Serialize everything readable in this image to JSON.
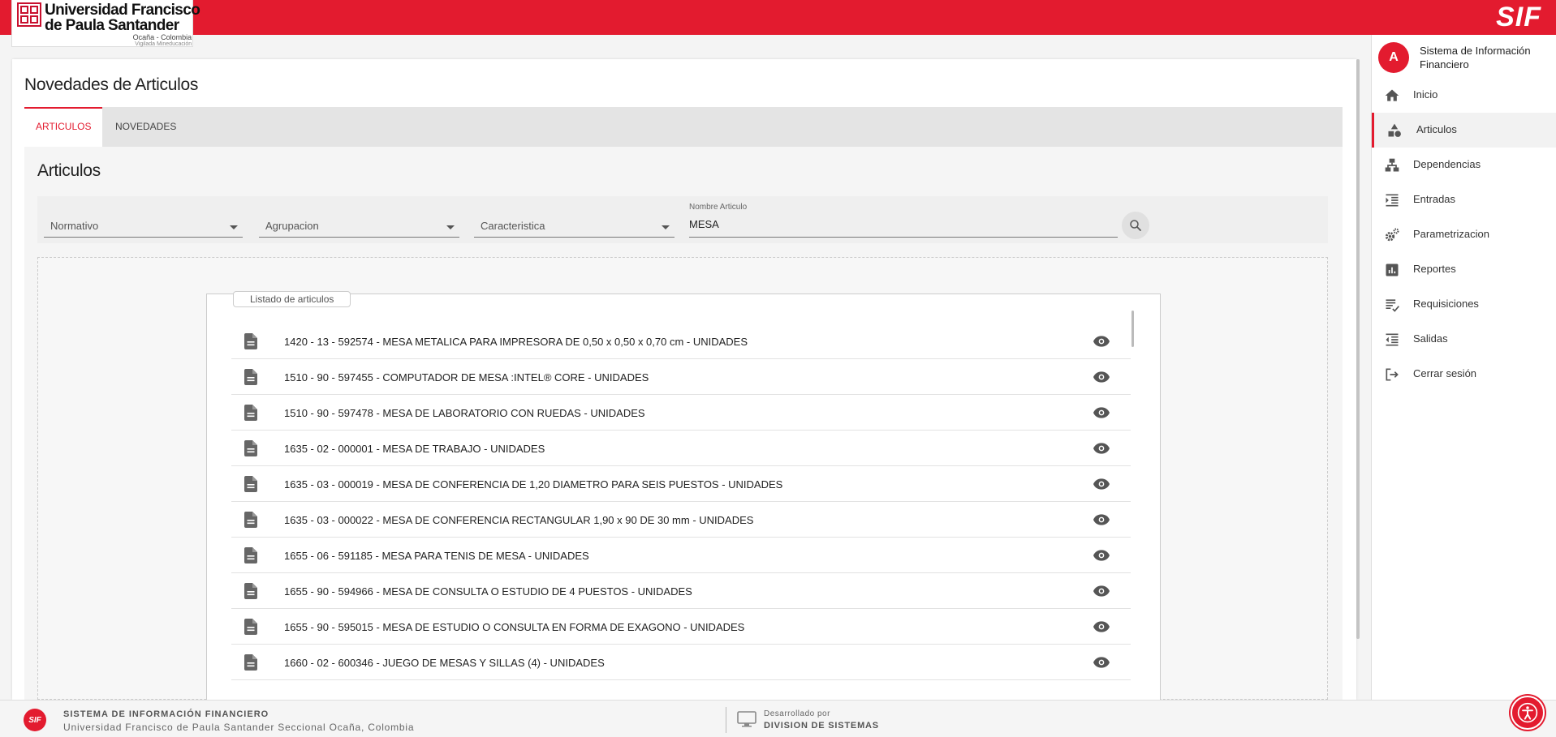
{
  "header": {
    "logo": {
      "line1": "Universidad Francisco",
      "line2": "de Paula Santander",
      "line3": "Ocaña - Colombia",
      "line4": "Vigilada Mineducación"
    },
    "brand": "SIF"
  },
  "page": {
    "title": "Novedades de Articulos",
    "tabs": [
      {
        "label": "ARTICULOS",
        "active": true
      },
      {
        "label": "NOVEDADES",
        "active": false
      }
    ],
    "section_title": "Articulos"
  },
  "filters": {
    "normativo": "Normativo",
    "agrupacion": "Agrupacion",
    "caracteristica": "Caracteristica",
    "nombre_label": "Nombre Articulo",
    "nombre_value": "MESA"
  },
  "listing": {
    "legend": "Listado de articulos",
    "items": [
      "1420 - 13 - 592574 - MESA METALICA PARA IMPRESORA DE 0,50 x 0,50 x 0,70 cm - UNIDADES",
      "1510 - 90 - 597455 - COMPUTADOR DE MESA :INTEL® CORE - UNIDADES",
      "1510 - 90 - 597478 - MESA DE LABORATORIO CON RUEDAS - UNIDADES",
      "1635 - 02 - 000001 - MESA DE TRABAJO - UNIDADES",
      "1635 - 03 - 000019 - MESA DE CONFERENCIA DE 1,20 DIAMETRO PARA SEIS PUESTOS - UNIDADES",
      "1635 - 03 - 000022 - MESA DE CONFERENCIA RECTANGULAR 1,90 x 90 DE 30 mm - UNIDADES",
      "1655 - 06 - 591185 - MESA PARA TENIS DE MESA - UNIDADES",
      "1655 - 90 - 594966 - MESA DE CONSULTA O ESTUDIO DE 4 PUESTOS - UNIDADES",
      "1655 - 90 - 595015 - MESA DE ESTUDIO O CONSULTA EN FORMA DE EXAGONO - UNIDADES",
      "1660 - 02 - 600346 - JUEGO DE MESAS Y SILLAS (4) - UNIDADES"
    ]
  },
  "sidebar": {
    "avatar": "A",
    "user_name": "Sistema de Información Financiero",
    "items": [
      {
        "label": "Inicio",
        "icon": "home-icon"
      },
      {
        "label": "Articulos",
        "icon": "shapes-icon",
        "active": true
      },
      {
        "label": "Dependencias",
        "icon": "hierarchy-icon"
      },
      {
        "label": "Entradas",
        "icon": "indent-icon"
      },
      {
        "label": "Parametrizacion",
        "icon": "gears-icon"
      },
      {
        "label": "Reportes",
        "icon": "chart-icon"
      },
      {
        "label": "Requisiciones",
        "icon": "checklist-icon"
      },
      {
        "label": "Salidas",
        "icon": "outdent-icon"
      },
      {
        "label": "Cerrar sesión",
        "icon": "logout-icon"
      }
    ]
  },
  "footer": {
    "logo": "SIF",
    "title": "SISTEMA DE INFORMACIÓN FINANCIERO",
    "subtitle": "Universidad Francisco de Paula Santander Seccional Ocaña, Colombia",
    "dev_label": "Desarrollado por",
    "dev_name": "DIVISION DE SISTEMAS"
  },
  "colors": {
    "accent": "#e31b2f"
  }
}
